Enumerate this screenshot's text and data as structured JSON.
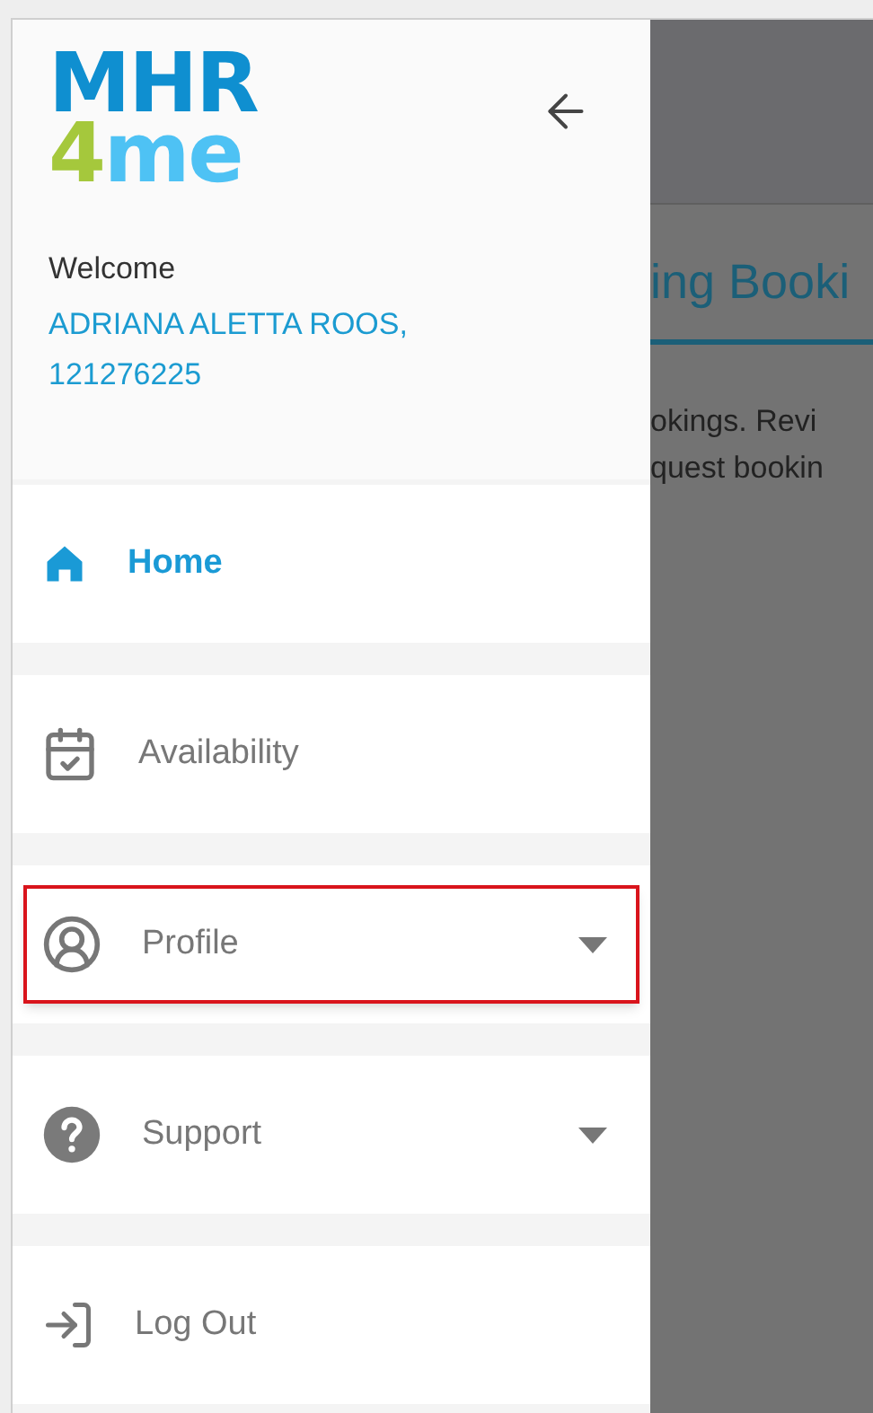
{
  "logo": {
    "line_1": "MHR",
    "line_2_number": "4",
    "line_2_text": "me"
  },
  "welcome": {
    "label": "Welcome",
    "user": "ADRIANA ALETTA ROOS, 121276225"
  },
  "menu": [
    {
      "label": "Home",
      "selected": true,
      "highlighted": false,
      "expandable": false
    },
    {
      "label": "Availability",
      "selected": false,
      "highlighted": false,
      "expandable": false
    },
    {
      "label": "Profile",
      "selected": false,
      "highlighted": true,
      "expandable": true
    },
    {
      "label": "Support",
      "selected": false,
      "highlighted": false,
      "expandable": true
    },
    {
      "label": "Log Out",
      "selected": false,
      "highlighted": false,
      "expandable": false
    }
  ],
  "background_page": {
    "tab": "ing Booki",
    "text_lines": [
      "okings. Revi",
      "quest bookin"
    ]
  }
}
